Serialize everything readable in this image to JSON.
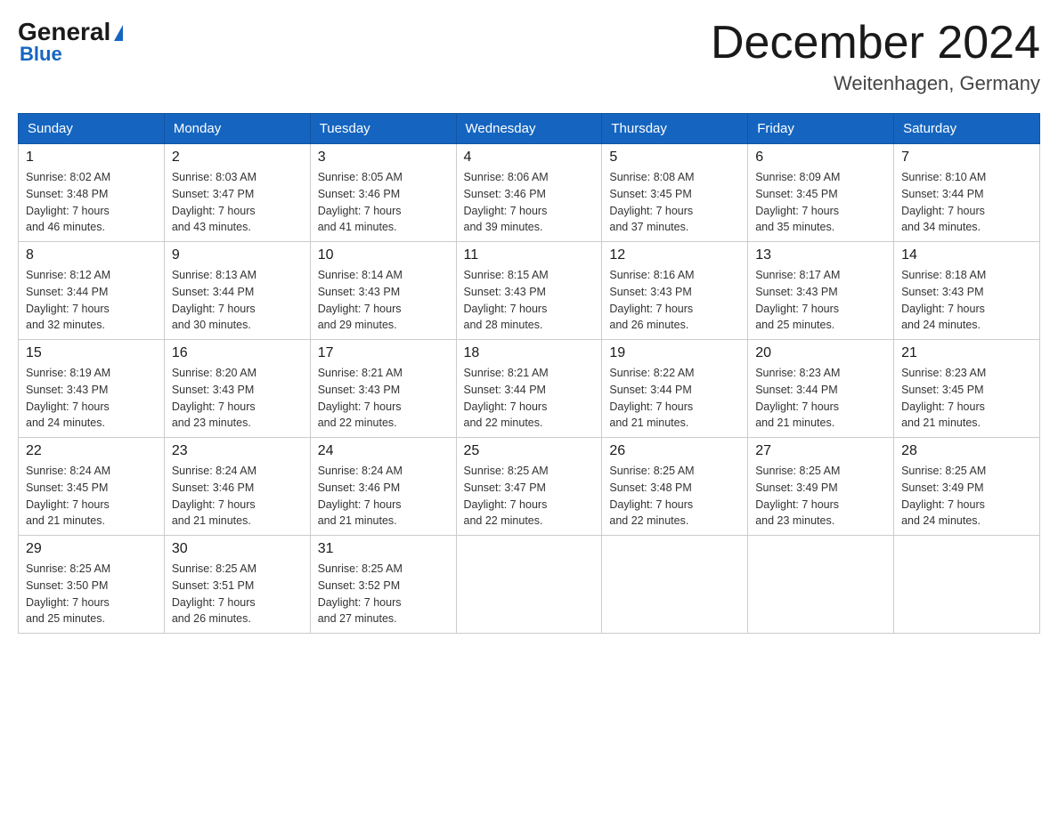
{
  "header": {
    "logo_general": "General",
    "logo_blue": "Blue",
    "month_title": "December 2024",
    "location": "Weitenhagen, Germany"
  },
  "days_of_week": [
    "Sunday",
    "Monday",
    "Tuesday",
    "Wednesday",
    "Thursday",
    "Friday",
    "Saturday"
  ],
  "weeks": [
    [
      {
        "day": "1",
        "sunrise": "8:02 AM",
        "sunset": "3:48 PM",
        "daylight": "7 hours and 46 minutes."
      },
      {
        "day": "2",
        "sunrise": "8:03 AM",
        "sunset": "3:47 PM",
        "daylight": "7 hours and 43 minutes."
      },
      {
        "day": "3",
        "sunrise": "8:05 AM",
        "sunset": "3:46 PM",
        "daylight": "7 hours and 41 minutes."
      },
      {
        "day": "4",
        "sunrise": "8:06 AM",
        "sunset": "3:46 PM",
        "daylight": "7 hours and 39 minutes."
      },
      {
        "day": "5",
        "sunrise": "8:08 AM",
        "sunset": "3:45 PM",
        "daylight": "7 hours and 37 minutes."
      },
      {
        "day": "6",
        "sunrise": "8:09 AM",
        "sunset": "3:45 PM",
        "daylight": "7 hours and 35 minutes."
      },
      {
        "day": "7",
        "sunrise": "8:10 AM",
        "sunset": "3:44 PM",
        "daylight": "7 hours and 34 minutes."
      }
    ],
    [
      {
        "day": "8",
        "sunrise": "8:12 AM",
        "sunset": "3:44 PM",
        "daylight": "7 hours and 32 minutes."
      },
      {
        "day": "9",
        "sunrise": "8:13 AM",
        "sunset": "3:44 PM",
        "daylight": "7 hours and 30 minutes."
      },
      {
        "day": "10",
        "sunrise": "8:14 AM",
        "sunset": "3:43 PM",
        "daylight": "7 hours and 29 minutes."
      },
      {
        "day": "11",
        "sunrise": "8:15 AM",
        "sunset": "3:43 PM",
        "daylight": "7 hours and 28 minutes."
      },
      {
        "day": "12",
        "sunrise": "8:16 AM",
        "sunset": "3:43 PM",
        "daylight": "7 hours and 26 minutes."
      },
      {
        "day": "13",
        "sunrise": "8:17 AM",
        "sunset": "3:43 PM",
        "daylight": "7 hours and 25 minutes."
      },
      {
        "day": "14",
        "sunrise": "8:18 AM",
        "sunset": "3:43 PM",
        "daylight": "7 hours and 24 minutes."
      }
    ],
    [
      {
        "day": "15",
        "sunrise": "8:19 AM",
        "sunset": "3:43 PM",
        "daylight": "7 hours and 24 minutes."
      },
      {
        "day": "16",
        "sunrise": "8:20 AM",
        "sunset": "3:43 PM",
        "daylight": "7 hours and 23 minutes."
      },
      {
        "day": "17",
        "sunrise": "8:21 AM",
        "sunset": "3:43 PM",
        "daylight": "7 hours and 22 minutes."
      },
      {
        "day": "18",
        "sunrise": "8:21 AM",
        "sunset": "3:44 PM",
        "daylight": "7 hours and 22 minutes."
      },
      {
        "day": "19",
        "sunrise": "8:22 AM",
        "sunset": "3:44 PM",
        "daylight": "7 hours and 21 minutes."
      },
      {
        "day": "20",
        "sunrise": "8:23 AM",
        "sunset": "3:44 PM",
        "daylight": "7 hours and 21 minutes."
      },
      {
        "day": "21",
        "sunrise": "8:23 AM",
        "sunset": "3:45 PM",
        "daylight": "7 hours and 21 minutes."
      }
    ],
    [
      {
        "day": "22",
        "sunrise": "8:24 AM",
        "sunset": "3:45 PM",
        "daylight": "7 hours and 21 minutes."
      },
      {
        "day": "23",
        "sunrise": "8:24 AM",
        "sunset": "3:46 PM",
        "daylight": "7 hours and 21 minutes."
      },
      {
        "day": "24",
        "sunrise": "8:24 AM",
        "sunset": "3:46 PM",
        "daylight": "7 hours and 21 minutes."
      },
      {
        "day": "25",
        "sunrise": "8:25 AM",
        "sunset": "3:47 PM",
        "daylight": "7 hours and 22 minutes."
      },
      {
        "day": "26",
        "sunrise": "8:25 AM",
        "sunset": "3:48 PM",
        "daylight": "7 hours and 22 minutes."
      },
      {
        "day": "27",
        "sunrise": "8:25 AM",
        "sunset": "3:49 PM",
        "daylight": "7 hours and 23 minutes."
      },
      {
        "day": "28",
        "sunrise": "8:25 AM",
        "sunset": "3:49 PM",
        "daylight": "7 hours and 24 minutes."
      }
    ],
    [
      {
        "day": "29",
        "sunrise": "8:25 AM",
        "sunset": "3:50 PM",
        "daylight": "7 hours and 25 minutes."
      },
      {
        "day": "30",
        "sunrise": "8:25 AM",
        "sunset": "3:51 PM",
        "daylight": "7 hours and 26 minutes."
      },
      {
        "day": "31",
        "sunrise": "8:25 AM",
        "sunset": "3:52 PM",
        "daylight": "7 hours and 27 minutes."
      },
      null,
      null,
      null,
      null
    ]
  ],
  "labels": {
    "sunrise": "Sunrise:",
    "sunset": "Sunset:",
    "daylight": "Daylight:"
  }
}
